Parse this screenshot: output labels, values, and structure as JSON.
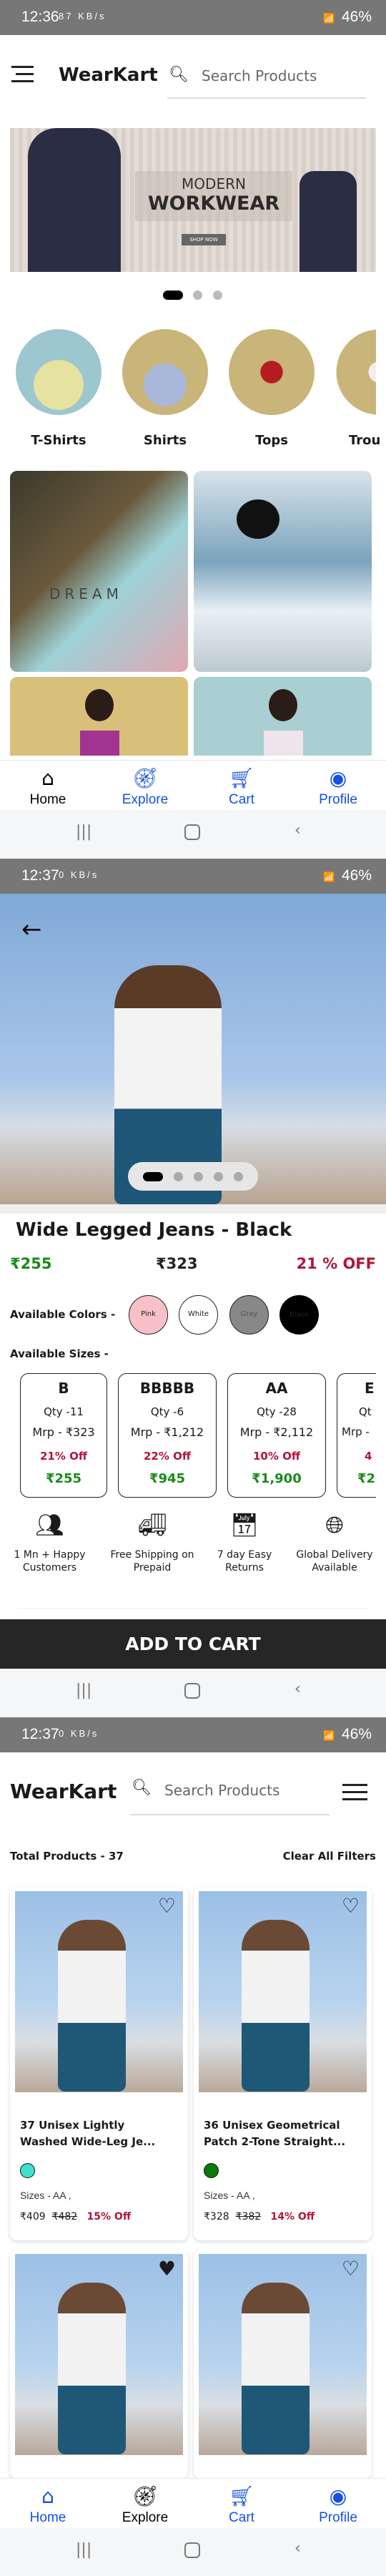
{
  "home": {
    "status": {
      "time": "12:36",
      "speed": "87 KB/s",
      "battery": "46%"
    },
    "brand": "WearKart",
    "search_placeholder": "Search Products",
    "banner": {
      "line1": "MODERN",
      "line2": "WORKWEAR",
      "cta": "SHOP NOW"
    },
    "carousel": {
      "total": 3,
      "active": 0
    },
    "categories": [
      {
        "label": "T-Shirts"
      },
      {
        "label": "Shirts"
      },
      {
        "label": "Tops"
      },
      {
        "label": "Trou"
      }
    ],
    "grid_text": "DREAM",
    "nav": [
      {
        "label": "Home",
        "icon": "home-icon",
        "active": true
      },
      {
        "label": "Explore",
        "icon": "compass-icon"
      },
      {
        "label": "Cart",
        "icon": "cart-icon"
      },
      {
        "label": "Profile",
        "icon": "profile-icon"
      }
    ]
  },
  "product": {
    "status": {
      "time": "12:37",
      "speed": "0 KB/s",
      "battery": "46%"
    },
    "carousel": {
      "total": 5,
      "active": 0
    },
    "title": "Wide Legged Jeans - Black",
    "price": "₹255",
    "mrp": "₹323",
    "discount": "21 % OFF",
    "colors_label": "Available Colors  -",
    "colors": [
      {
        "name": "Pink",
        "hex": "#f8c1c8"
      },
      {
        "name": "White",
        "hex": "#ffffff"
      },
      {
        "name": "Gray",
        "hex": "#888888"
      },
      {
        "name": "Black",
        "hex": "#000000"
      }
    ],
    "sizes_label": "Available Sizes  -",
    "sizes": [
      {
        "size": "B",
        "qty": "Qty -11",
        "mrp": "Mrp - ₹323",
        "off": "21% Off",
        "price": "₹255"
      },
      {
        "size": "BBBBB",
        "qty": "Qty -6",
        "mrp": "Mrp - ₹1,212",
        "off": "22% Off",
        "price": "₹945"
      },
      {
        "size": "AA",
        "qty": "Qty -28",
        "mrp": "Mrp - ₹2,112",
        "off": "10% Off",
        "price": "₹1,900"
      },
      {
        "size": "E",
        "qty": "Qt",
        "mrp": "Mrp -",
        "off": "4",
        "price": "₹2"
      }
    ],
    "features": [
      {
        "l1": "1 Mn + Happy",
        "l2": "Customers",
        "icon": "users-icon"
      },
      {
        "l1": "Free Shipping on",
        "l2": "Prepaid",
        "icon": "truck-icon"
      },
      {
        "l1": "7 day Easy",
        "l2": "Returns",
        "icon": "calendar-icon"
      },
      {
        "l1": "Global Delivery",
        "l2": "Available",
        "icon": "globe-icon"
      }
    ],
    "add_to_cart": "ADD TO CART",
    "colors_hex": {
      "green": "#1a8a1a",
      "red": "#b0163a"
    }
  },
  "listing": {
    "status": {
      "time": "12:37",
      "speed": "0 KB/s",
      "battery": "46%"
    },
    "brand": "WearKart",
    "search_placeholder": "Search Products",
    "total_label": "Total Products  - 37",
    "clear_filters": "Clear All Filters",
    "products": [
      {
        "l1": "37 Unisex Lightly",
        "l2": "Washed Wide-Leg Je...",
        "color": "#40e0d0",
        "sizes": "Sizes - AA ,",
        "price": "₹409",
        "mrp": "₹482",
        "off": "15% Off",
        "favorite": false
      },
      {
        "l1": "36 Unisex Geometrical",
        "l2": "Patch 2-Tone Straight...",
        "color": "#0a7a0a",
        "sizes": "Sizes - AA ,",
        "price": "₹328",
        "mrp": "₹382",
        "off": "14% Off",
        "favorite": false
      },
      {
        "favorite": true
      },
      {
        "favorite": false
      }
    ],
    "nav": [
      {
        "label": "Home",
        "icon": "home-icon"
      },
      {
        "label": "Explore",
        "icon": "compass-icon",
        "active": true
      },
      {
        "label": "Cart",
        "icon": "cart-icon"
      },
      {
        "label": "Profile",
        "icon": "profile-icon"
      }
    ]
  }
}
